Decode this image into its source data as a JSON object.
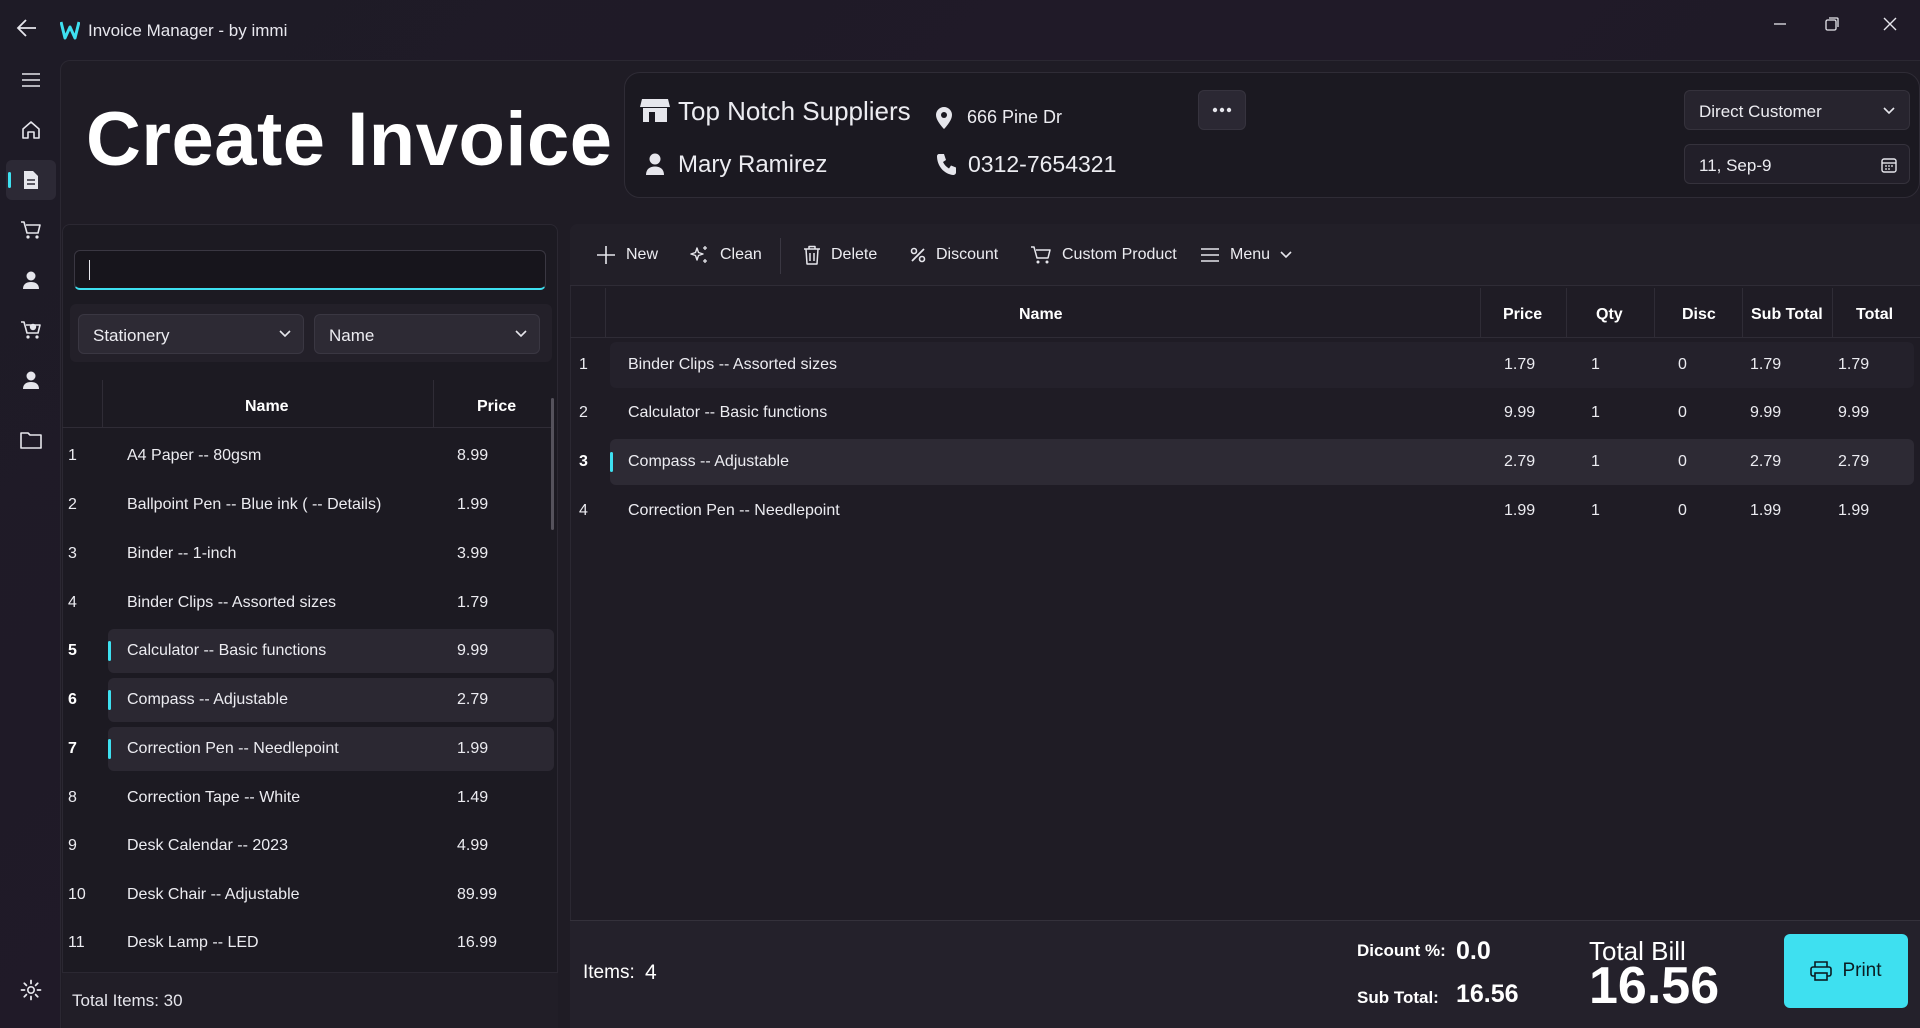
{
  "app": {
    "title": "Invoice Manager - by immi"
  },
  "icons": {
    "back": "back-arrow-icon",
    "logo": "app-logo-icon",
    "minimize": "minimize-icon",
    "restore": "restore-icon",
    "close": "close-icon"
  },
  "nav": {
    "items": [
      "hamburger-menu-icon",
      "home-icon",
      "document-icon",
      "cart-icon",
      "person-icon",
      "cart-add-icon",
      "user-icon",
      "folder-icon",
      "settings-icon"
    ],
    "active_index": 2
  },
  "page": {
    "title": "Create Invoice"
  },
  "supplier": {
    "name": "Top Notch Suppliers",
    "contact": "Mary Ramirez",
    "address": "666 Pine Dr",
    "phone": "0312-7654321"
  },
  "customer_type": {
    "selected": "Direct Customer"
  },
  "invoice_date": "11, Sep-9",
  "product_panel": {
    "search_value": "",
    "category": "Stationery",
    "sort_by": "Name",
    "columns": {
      "name": "Name",
      "price": "Price"
    },
    "rows": [
      {
        "num": "1",
        "name": "A4 Paper -- 80gsm",
        "price": "8.99",
        "selected": false
      },
      {
        "num": "2",
        "name": "Ballpoint Pen -- Blue ink ( -- Details)",
        "price": "1.99",
        "selected": false
      },
      {
        "num": "3",
        "name": "Binder -- 1-inch",
        "price": "3.99",
        "selected": false
      },
      {
        "num": "4",
        "name": "Binder Clips -- Assorted sizes",
        "price": "1.79",
        "selected": false
      },
      {
        "num": "5",
        "name": "Calculator -- Basic functions",
        "price": "9.99",
        "selected": true
      },
      {
        "num": "6",
        "name": "Compass -- Adjustable",
        "price": "2.79",
        "selected": true
      },
      {
        "num": "7",
        "name": "Correction Pen -- Needlepoint",
        "price": "1.99",
        "selected": true
      },
      {
        "num": "8",
        "name": "Correction Tape -- White",
        "price": "1.49",
        "selected": false
      },
      {
        "num": "9",
        "name": "Desk Calendar -- 2023",
        "price": "4.99",
        "selected": false
      },
      {
        "num": "10",
        "name": "Desk Chair -- Adjustable",
        "price": "89.99",
        "selected": false
      },
      {
        "num": "11",
        "name": "Desk Lamp -- LED",
        "price": "16.99",
        "selected": false
      }
    ],
    "total_items_text": "Total Items: 30"
  },
  "toolbar": {
    "new": "New",
    "clean": "Clean",
    "delete": "Delete",
    "discount": "Discount",
    "custom_product": "Custom Product",
    "menu": "Menu"
  },
  "invoice_table": {
    "columns": {
      "name": "Name",
      "price": "Price",
      "qty": "Qty",
      "disc": "Disc",
      "subtotal": "Sub Total",
      "total": "Total"
    },
    "rows": [
      {
        "num": "1",
        "name": "Binder Clips -- Assorted sizes",
        "price": "1.79",
        "qty": "1",
        "disc": "0",
        "subtotal": "1.79",
        "total": "1.79",
        "selected": false
      },
      {
        "num": "2",
        "name": "Calculator -- Basic functions",
        "price": "9.99",
        "qty": "1",
        "disc": "0",
        "subtotal": "9.99",
        "total": "9.99",
        "selected": false
      },
      {
        "num": "3",
        "name": "Compass -- Adjustable",
        "price": "2.79",
        "qty": "1",
        "disc": "0",
        "subtotal": "2.79",
        "total": "2.79",
        "selected": true
      },
      {
        "num": "4",
        "name": "Correction Pen -- Needlepoint",
        "price": "1.99",
        "qty": "1",
        "disc": "0",
        "subtotal": "1.99",
        "total": "1.99",
        "selected": false
      }
    ]
  },
  "summary": {
    "items_label": "Items:",
    "items_count": "4",
    "discount_label": "Dicount %:",
    "discount_value": "0.0",
    "subtotal_label": "Sub Total:",
    "subtotal_value": "16.56",
    "total_label": "Total Bill",
    "total_value": "16.56",
    "print_label": "Print"
  },
  "colors": {
    "accent": "#3ee0f0",
    "background": "#1f1c25"
  }
}
